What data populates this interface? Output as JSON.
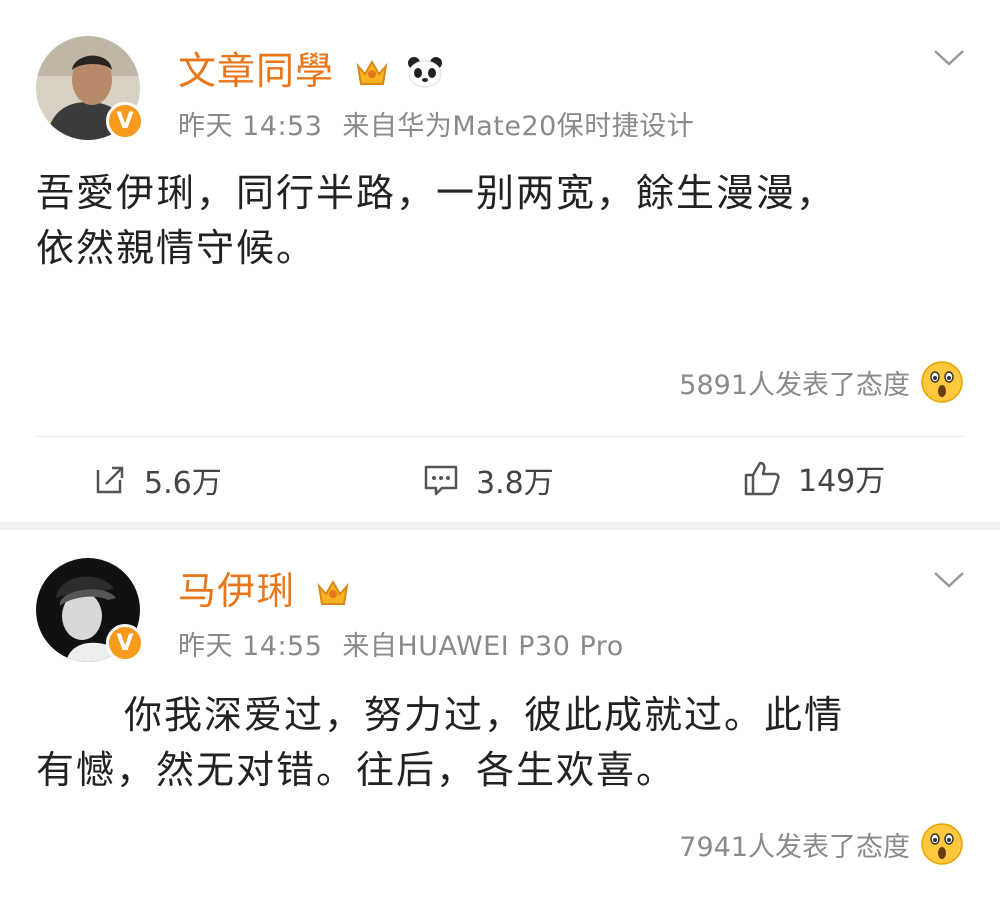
{
  "posts": [
    {
      "username": "文章同學",
      "time": "昨天 14:53",
      "source": "来自华为Mate20保时捷设计",
      "content_lines": [
        "吾愛伊琍，同行半路，一别两宽，餘生漫漫，",
        "依然親情守候。"
      ],
      "reactions": "5891人发表了态度",
      "actions": {
        "repost": "5.6万",
        "comment": "3.8万",
        "like": "149万"
      }
    },
    {
      "username": "马伊琍",
      "time": "昨天 14:55",
      "source": "来自HUAWEI P30 Pro",
      "content_lines": [
        "你我深爱过，努力过，彼此成就过。此情",
        "有憾，然无对错。往后，各生欢喜。"
      ],
      "reactions": "7941人发表了态度"
    }
  ],
  "verified_badge": "V",
  "colors": {
    "username": "#e8761a",
    "meta": "#8a8a8a",
    "badge": "#f79a1e"
  },
  "icons": [
    "crown-icon",
    "panda-icon",
    "chevron-down-icon",
    "surprised-emoji-icon",
    "repost-icon",
    "comment-icon",
    "like-icon"
  ]
}
